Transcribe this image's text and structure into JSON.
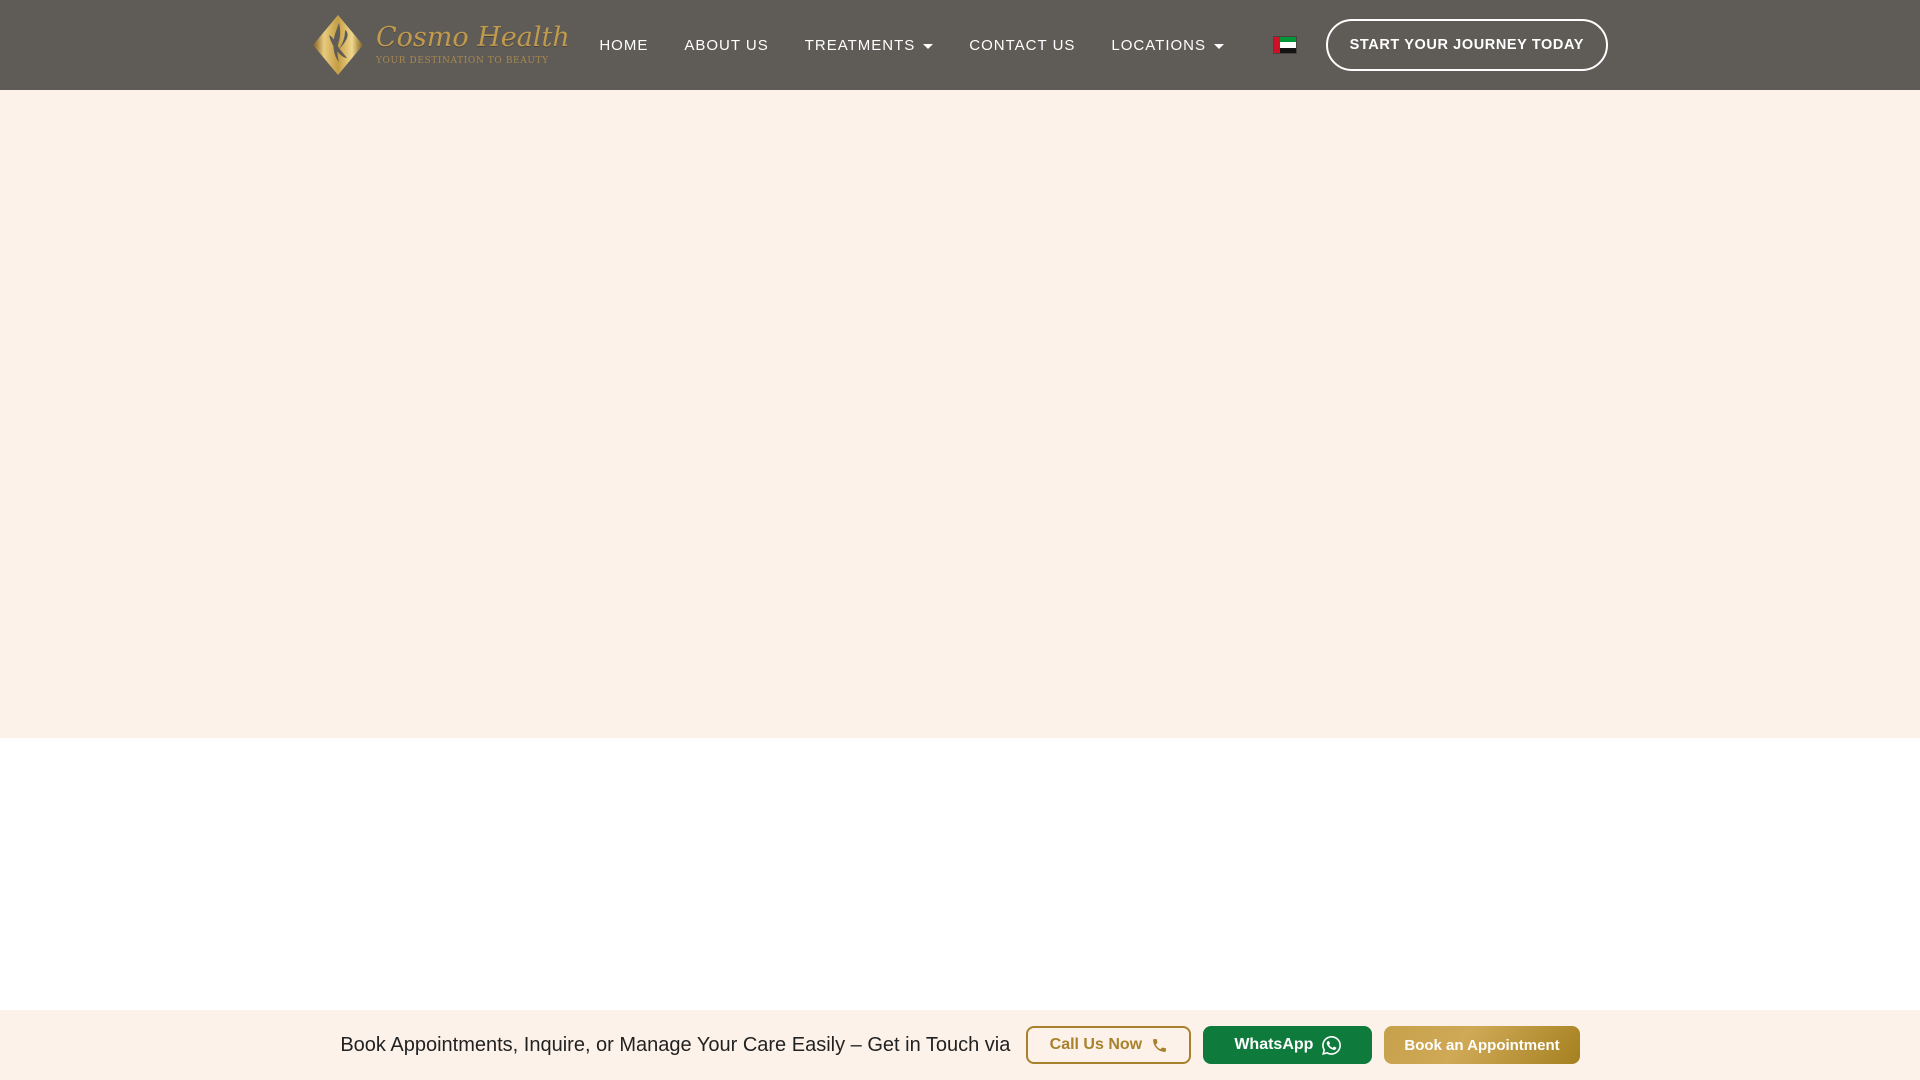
{
  "header": {
    "logo": {
      "brand": "Cosmo Health",
      "tagline": "YOUR DESTINATION TO BEAUTY",
      "icon": "gold-diamond-flower-logo"
    },
    "nav": [
      {
        "label": "HOME",
        "dropdown": false
      },
      {
        "label": "ABOUT US",
        "dropdown": false
      },
      {
        "label": "TREATMENTS",
        "dropdown": true
      },
      {
        "label": "CONTACT US",
        "dropdown": false
      },
      {
        "label": "LOCATIONS",
        "dropdown": true
      }
    ],
    "language": {
      "icon": "uae-flag-icon"
    },
    "cta": {
      "label": "START YOUR JOURNEY TODAY"
    }
  },
  "contact_bar": {
    "message": "Book Appointments, Inquire, or Manage Your Care Easily – Get in Touch via",
    "buttons": [
      {
        "label": "Call Us Now",
        "icon": "phone-icon",
        "style": "outline-gold"
      },
      {
        "label": "WhatsApp",
        "icon": "whatsapp-icon",
        "style": "green"
      },
      {
        "label": "Book an Appointment",
        "icon": null,
        "style": "gold-gradient"
      }
    ]
  },
  "colors": {
    "header_bg": "#5f5b57",
    "cream_bg": "#fdf2e9",
    "white_bg": "#ffffff",
    "gold_accent": "#a8812c",
    "logo_gold": "#c09a4d",
    "whatsapp_green": "#0e7a3c",
    "gold_gradient_start": "#c7a04b",
    "gold_gradient_end": "#a5801f",
    "nav_text": "#ffffff",
    "message_text": "#222222"
  }
}
